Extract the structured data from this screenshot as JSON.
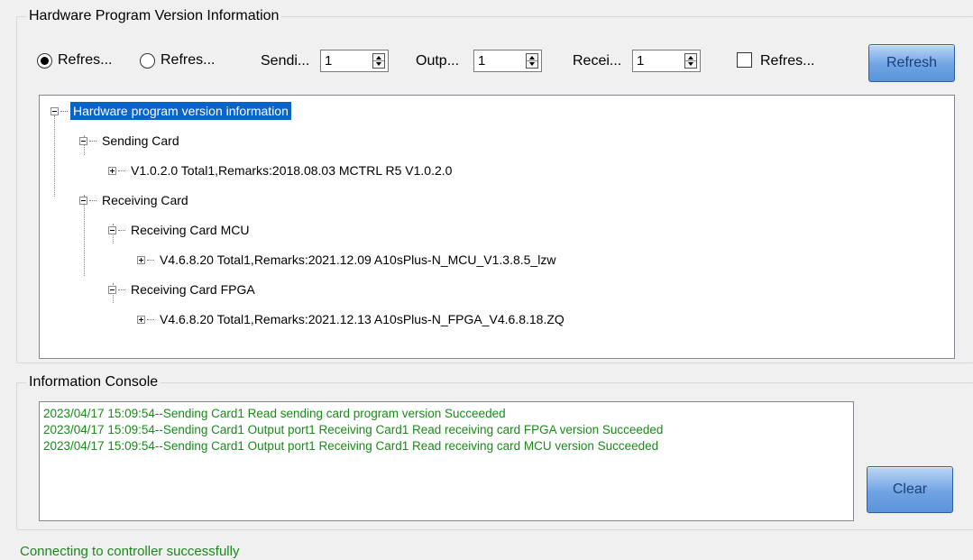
{
  "hardware_group": {
    "title": "Hardware Program Version Information",
    "radio_1_label": "Refres...",
    "radio_2_label": "Refres...",
    "sending_label": "Sendi...",
    "sending_value": "1",
    "output_label": "Outp...",
    "output_value": "1",
    "receiving_label": "Recei...",
    "receiving_value": "1",
    "checkbox_label": "Refres...",
    "refresh_button": "Refresh"
  },
  "tree": {
    "root": "Hardware program version information",
    "sending_card": "Sending Card",
    "sending_card_version": "V1.0.2.0 Total1,Remarks:2018.08.03 MCTRL R5 V1.0.2.0",
    "receiving_card": "Receiving Card",
    "receiving_mcu": "Receiving Card MCU",
    "receiving_mcu_version": "V4.6.8.20 Total1,Remarks:2021.12.09 A10sPlus-N_MCU_V1.3.8.5_lzw",
    "receiving_fpga": "Receiving Card FPGA",
    "receiving_fpga_version": "V4.6.8.20 Total1,Remarks:2021.12.13 A10sPlus-N_FPGA_V4.6.8.18.ZQ"
  },
  "console_group": {
    "title": "Information Console",
    "lines": [
      "2023/04/17 15:09:54--Sending Card1 Read sending card program version Succeeded",
      "2023/04/17 15:09:54--Sending Card1 Output port1 Receiving Card1 Read receiving card FPGA version Succeeded",
      "2023/04/17 15:09:54--Sending Card1 Output port1 Receiving Card1 Read receiving card MCU version Succeeded"
    ],
    "clear_button": "Clear"
  },
  "status_bar": {
    "text": "Connecting to controller successfully"
  },
  "colors": {
    "log_text": "#1a8a1a",
    "selection": "#0a64c8",
    "button_blue": "#5b94da"
  }
}
